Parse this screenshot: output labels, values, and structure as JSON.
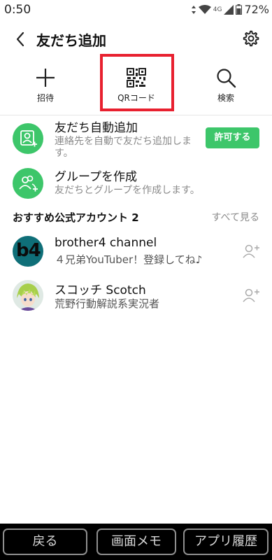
{
  "status_bar": {
    "time": "0:50",
    "network": "4G",
    "battery": "72%"
  },
  "header": {
    "title": "友だち追加"
  },
  "tabs": [
    {
      "label": "招待",
      "icon": "plus-icon"
    },
    {
      "label": "QRコード",
      "icon": "qr-code-icon"
    },
    {
      "label": "検索",
      "icon": "search-icon"
    }
  ],
  "auto_add": {
    "title": "友だち自動追加",
    "description": "連絡先を自動で友だち追加します。",
    "button": "許可する"
  },
  "create_group": {
    "title": "グループを作成",
    "description": "友だちとグループを作成します。"
  },
  "recommended": {
    "title": "おすすめ公式アカウント 2",
    "see_all": "すべて見る",
    "accounts": [
      {
        "name": "brother4 channel",
        "description": "４兄弟YouTuber！登録してね♪",
        "avatar_text": "b4"
      },
      {
        "name": "スコッチ Scotch",
        "description": "荒野行動解説系実況者"
      }
    ]
  },
  "nav_bar": {
    "back": "戻る",
    "memo": "画面メモ",
    "history": "アプリ履歴"
  },
  "colors": {
    "accent_green": "#3dc66a",
    "highlight_red": "#e8202f"
  }
}
